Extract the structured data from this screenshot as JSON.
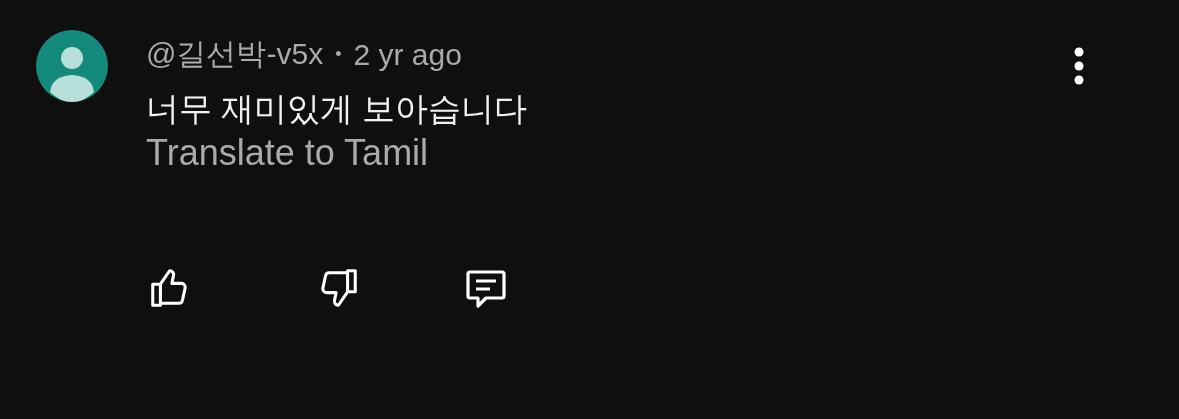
{
  "comment": {
    "author": "@길선박-v5x",
    "separator": "•",
    "time": "2 yr ago",
    "text": "너무 재미있게 보아습니다",
    "translate": "Translate to Tamil"
  }
}
